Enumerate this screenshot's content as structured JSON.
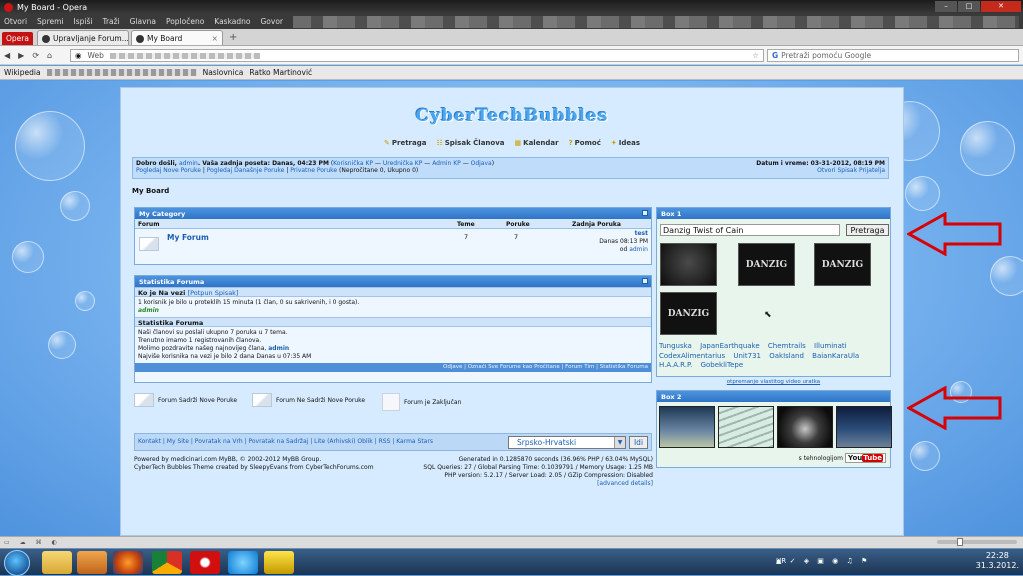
{
  "browser": {
    "title": "My Board - Opera",
    "menu": [
      "Otvori",
      "Spremi",
      "Ispiši",
      "Traži",
      "Glavna",
      "Popločeno",
      "Kaskadno",
      "Govor"
    ],
    "opera_button": "Opera",
    "tabs": [
      {
        "label": "Upravljanje Forum..."
      },
      {
        "label": "My Board"
      }
    ],
    "web_label": "Web",
    "search_placeholder": "Pretraži pomoću Google",
    "bookmarks": [
      "Wikipedia",
      "Naslovnica",
      "Ratko Martinović"
    ]
  },
  "forum": {
    "logo": "CyberTechBubbles",
    "nav": [
      "Pretraga",
      "Spisak Članova",
      "Kalendar",
      "Pomoć",
      "Ideas"
    ],
    "welcome": {
      "greeting": "Dobro došli, ",
      "user": "admin",
      "last_visit": ". Vaša zadnja poseta: Danas, 04:23 PM",
      "cp_link": "Korisnička KP",
      "editor_link": "Urednička KP",
      "admin_link": "Admin KP",
      "logout": "Odjava",
      "line2a": "Pogledaj Nove Poruke",
      "line2b": "Pogledaj Današnje Poruke",
      "line2c": "Privatne Poruke",
      "line2d": "(Nepročitane 0, Ukupno 0)",
      "datetime": "Datum i vreme: 03-31-2012, 08:19 PM",
      "open_list": "Otvori Spisak Prijatelja"
    },
    "breadcrumb": "My Board",
    "category": {
      "title": "My Category",
      "col_forum": "Forum",
      "col_topics": "Teme",
      "col_posts": "Poruke",
      "col_last": "Zadnja Poruka",
      "forum_name": "My Forum",
      "topics": "7",
      "posts": "7",
      "last_title": "test",
      "last_time": "Danas 08:13 PM",
      "last_by_prefix": "od ",
      "last_by": "admin"
    },
    "stats": {
      "title": "Statistika Foruma",
      "online_header": "Ko je Na vezi",
      "online_link": "[Potpun Spisak]",
      "online_text": "1 korisnik je bilo u proteklih 15 minuta (1 član, 0 su sakrivenih, i 0 gosta).",
      "online_user": "admin",
      "stats_header": "Statistika Foruma",
      "line1": "Naši članovi su poslali ukupno 7 poruka u 7 tema.",
      "line2": "Trenutno imamo 1 registrovanih članova.",
      "line3": "Molimo pozdravite našeg najnovijeg člana, ",
      "newest": "admin",
      "line4": "Najviše korisnika na vezi je bilo 2 dana Danas u 07:35 AM",
      "footer": "Odjave | Označi Sve Forume kao Pročitane | Forum Tim | Statistika Foruma"
    },
    "legend": {
      "new": "Forum Sadrži Nove Poruke",
      "nonew": "Forum Ne Sadrži Nove Poruke",
      "locked": "Forum je Zaključan"
    },
    "bottom_links": "Kontakt | My Site | Povratak na Vrh | Povratak na Sadržaj | Lite (Arhivski) Oblik | RSS | Karma Stars",
    "language": "Srpsko-Hrvatski",
    "go_button": "Idi",
    "powered": [
      "Powered by medicinari.com MyBB, © 2002-2012 MyBB Group.",
      "CyberTech Bubbles Theme created by SleepyEvans from CyberTechForums.com"
    ],
    "server_stats": [
      "Generated in 0.1285870 seconds (36.96% PHP / 63.04% MySQL)",
      "SQL Queries: 27 / Global Parsing Time: 0.1039791 / Memory Usage: 1.25 MB",
      "PHP version: 5.2.17 / Server Load: 2.05 / GZip Compression: Disabled",
      "[advanced details]"
    ],
    "box1": {
      "title": "Box 1",
      "search_value": "Danzig Twist of Cain",
      "search_button": "Pretraga",
      "thumbs": [
        "",
        "DANZIG",
        "DANZIG",
        "DANZIG"
      ],
      "tags": [
        "Tunguska",
        "JapanEarthquake",
        "Chemtrails",
        "Illuminati",
        "CodexAlimentarius",
        "Unit731",
        "OakIsland",
        "BaianKaraUla",
        "H.A.A.R.P.",
        "GobekliTepe"
      ],
      "video_link": "otpremanje vlastitog video uratka"
    },
    "box2": {
      "title": "Box 2",
      "tech": "s tehnologijom",
      "youtube_you": "You",
      "youtube_tube": "Tube"
    }
  },
  "taskbar": {
    "lang": "HR",
    "time": "22:28",
    "date": "31.3.2012."
  },
  "colors": {
    "accent": "#2f73c6",
    "arrow": "#d80000",
    "link": "#1b5fb4"
  }
}
